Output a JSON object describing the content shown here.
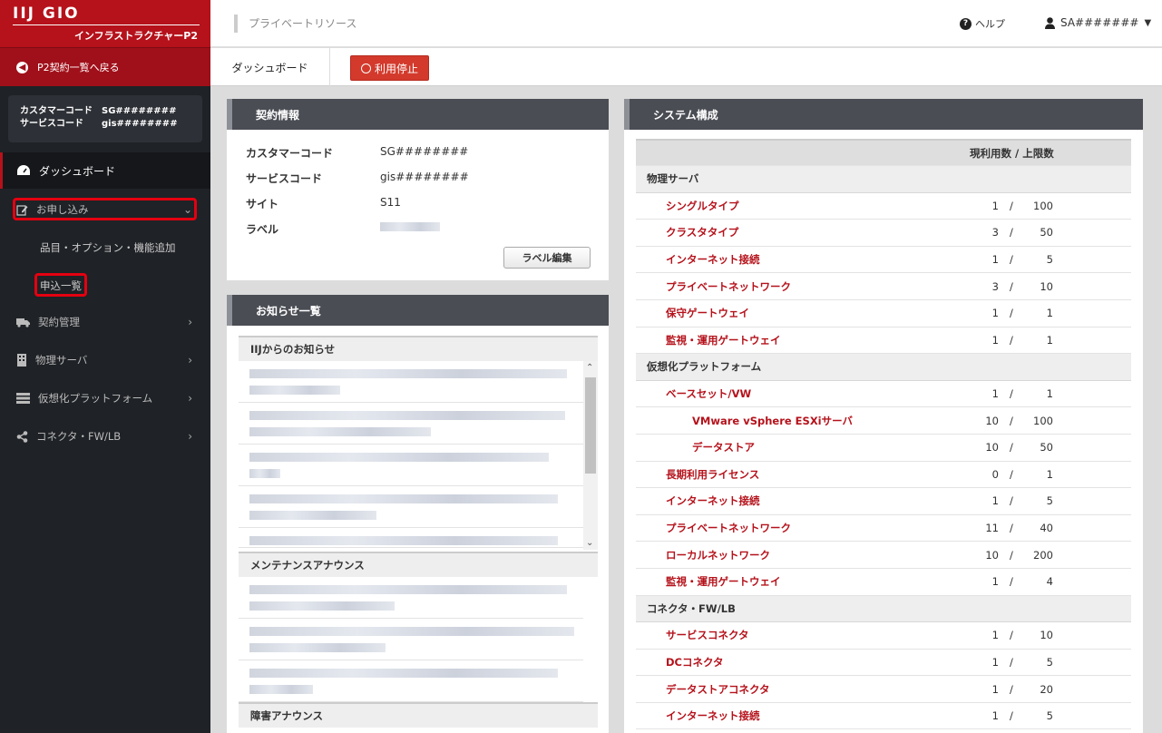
{
  "brand": {
    "logo": "IIJ GIO",
    "subtitle": "インフラストラクチャーP2"
  },
  "nav": {
    "back_label": "P2契約一覧へ戻る",
    "customer_code_label": "カスタマーコード",
    "customer_code_value": "SG########",
    "service_code_label": "サービスコード",
    "service_code_value": "gis########",
    "items": [
      {
        "label": "ダッシュボード"
      },
      {
        "label": "お申し込み"
      },
      {
        "label": "品目・オプション・機能追加"
      },
      {
        "label": "申込一覧"
      },
      {
        "label": "契約管理"
      },
      {
        "label": "物理サーバ"
      },
      {
        "label": "仮想化プラットフォーム"
      },
      {
        "label": "コネクタ・FW/LB"
      }
    ]
  },
  "header": {
    "breadcrumb": "プライベートリソース",
    "help": "ヘルプ",
    "user": "SA#######"
  },
  "tabs": {
    "dashboard": "ダッシュボード",
    "stop_label": "利用停止"
  },
  "contract": {
    "title": "契約情報",
    "rows": [
      {
        "k": "カスタマーコード",
        "v": "SG########"
      },
      {
        "k": "サービスコード",
        "v": "gis########"
      },
      {
        "k": "サイト",
        "v": "S11"
      },
      {
        "k": "ラベル",
        "v": ""
      }
    ],
    "edit_label": "ラベル編集"
  },
  "news": {
    "title": "お知らせ一覧",
    "sections": [
      "IIJからのお知らせ",
      "メンテナンスアナウンス",
      "障害アナウンス"
    ]
  },
  "system": {
    "title": "システム構成",
    "header": "現利用数 / 上限数",
    "rows": [
      {
        "type": "group",
        "name": "物理サーバ"
      },
      {
        "type": "item",
        "level": 1,
        "name": "シングルタイプ",
        "cur": "1",
        "max": "100"
      },
      {
        "type": "item",
        "level": 1,
        "name": "クラスタタイプ",
        "cur": "3",
        "max": "50"
      },
      {
        "type": "item",
        "level": 1,
        "name": "インターネット接続",
        "cur": "1",
        "max": "5"
      },
      {
        "type": "item",
        "level": 1,
        "name": "プライベートネットワーク",
        "cur": "3",
        "max": "10"
      },
      {
        "type": "item",
        "level": 1,
        "name": "保守ゲートウェイ",
        "cur": "1",
        "max": "1"
      },
      {
        "type": "item",
        "level": 1,
        "name": "監視・運用ゲートウェイ",
        "cur": "1",
        "max": "1"
      },
      {
        "type": "group",
        "name": "仮想化プラットフォーム"
      },
      {
        "type": "item",
        "level": 1,
        "name": "ベースセット/VW",
        "cur": "1",
        "max": "1"
      },
      {
        "type": "item",
        "level": 2,
        "name": "VMware vSphere ESXiサーバ",
        "cur": "10",
        "max": "100"
      },
      {
        "type": "item",
        "level": 2,
        "name": "データストア",
        "cur": "10",
        "max": "50"
      },
      {
        "type": "item",
        "level": 1,
        "name": "長期利用ライセンス",
        "cur": "0",
        "max": "1"
      },
      {
        "type": "item",
        "level": 1,
        "name": "インターネット接続",
        "cur": "1",
        "max": "5"
      },
      {
        "type": "item",
        "level": 1,
        "name": "プライベートネットワーク",
        "cur": "11",
        "max": "40"
      },
      {
        "type": "item",
        "level": 1,
        "name": "ローカルネットワーク",
        "cur": "10",
        "max": "200"
      },
      {
        "type": "item",
        "level": 1,
        "name": "監視・運用ゲートウェイ",
        "cur": "1",
        "max": "4"
      },
      {
        "type": "group",
        "name": "コネクタ・FW/LB"
      },
      {
        "type": "item",
        "level": 1,
        "name": "サービスコネクタ",
        "cur": "1",
        "max": "10"
      },
      {
        "type": "item",
        "level": 1,
        "name": "DCコネクタ",
        "cur": "1",
        "max": "5"
      },
      {
        "type": "item",
        "level": 1,
        "name": "データストアコネクタ",
        "cur": "1",
        "max": "20"
      },
      {
        "type": "item",
        "level": 1,
        "name": "インターネット接続",
        "cur": "1",
        "max": "5"
      }
    ]
  },
  "colors": {
    "brand_red": "#b5121b",
    "highlight": "#e40010",
    "sidebar": "#1f2226",
    "panel_head": "#4a4d54"
  }
}
